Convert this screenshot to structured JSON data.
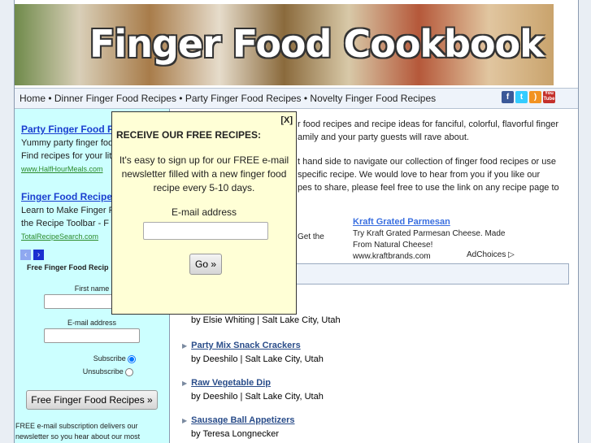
{
  "banner": {
    "title": "Finger Food Cookbook"
  },
  "nav": {
    "text": "Home • Dinner Finger Food Recipes • Party Finger Food Recipes • Novelty Finger Food Recipes",
    "social": [
      "facebook-icon",
      "twitter-icon",
      "rss-icon",
      "youtube-icon"
    ]
  },
  "sidebar": {
    "ads": [
      {
        "title": "Party Finger Food F",
        "line1": "Yummy party finger foo",
        "line2": "Find recipes for your lit",
        "url": "www.HalfHourMeals.com"
      },
      {
        "title": "Finger Food Recipe",
        "line1": "Learn to Make Finger F",
        "line2": "the Recipe Toolbar - F",
        "url": "TotalRecipeSearch.com"
      }
    ],
    "form_title": "Free Finger Food Recip",
    "first_name_label": "First name",
    "email_label": "E-mail address",
    "subscribe_label": "Subscribe",
    "unsubscribe_label": "Unsubscribe",
    "submit_label": "Free Finger Food Recipes »",
    "note1": "FREE e-mail subscription delivers our",
    "note2": "newsletter so you hear about our most"
  },
  "main": {
    "p1a": "r food recipes and recipe ideas for fanciful, colorful, flavorful finger",
    "p1b": "amily and your party guests will rave about.",
    "p2a": "t hand side to navigate our collection of finger food recipes or use",
    "p2b": "specific recipe. We would love to hear from you if you like our",
    "p2c": "pes to share, please feel free to use the link on any recipe page to",
    "ad_left": "Get the",
    "ad_title": "Kraft Grated Parmesan",
    "ad_line1": "Try Kraft Grated Parmesan Cheese. Made",
    "ad_line2": "From Natural Cheese!",
    "ad_url": "www.kraftbrands.com",
    "adchoices": "AdChoices"
  },
  "recipes": [
    {
      "title": "",
      "author": "by Elsie Whiting | Salt Lake City, Utah"
    },
    {
      "title": "Party Mix Snack Crackers",
      "author": "by Deeshilo | Salt Lake City, Utah"
    },
    {
      "title": "Raw Vegetable Dip",
      "author": "by Deeshilo | Salt Lake City, Utah"
    },
    {
      "title": "Sausage Ball Appetizers",
      "author": "by Teresa Longnecker"
    }
  ],
  "popup": {
    "close": "[X]",
    "heading": "RECEIVE OUR FREE RECIPES:",
    "body": "It's easy to sign up for our FREE e-mail newsletter filled with a new finger food recipe every 5-10 days.",
    "email_label": "E-mail address",
    "email_value": "",
    "go": "Go »"
  }
}
